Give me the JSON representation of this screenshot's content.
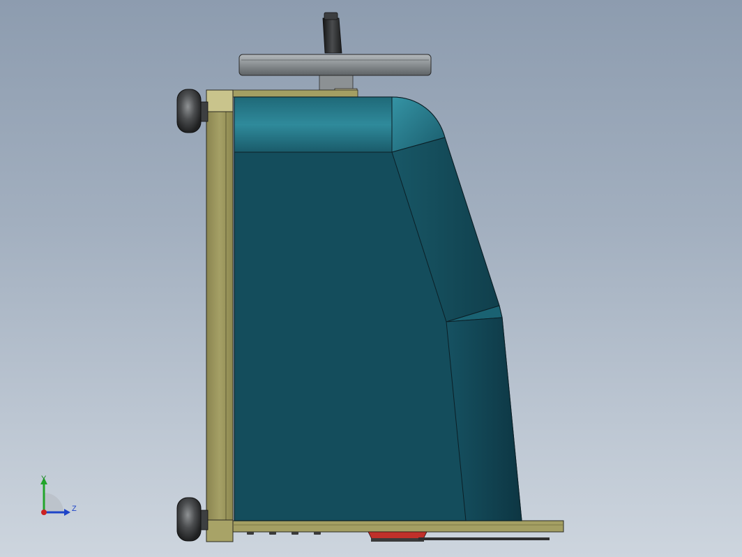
{
  "graphics_area": {
    "background_top": "#8d9caf",
    "background_bottom": "#cdd5de"
  },
  "model": {
    "view": "side",
    "body_color": "#144d5c",
    "body_highlight_color": "#2a8596",
    "frame_color": "#9a955c",
    "caster_color": "#3c3e40",
    "handwheel_color": "#8e9396",
    "handle_color": "#2a2c2e",
    "foot_accent_color": "#c0302a"
  },
  "triad": {
    "y_label": "Y",
    "z_label": "Z",
    "y_color": "#22a52b",
    "z_color": "#1e44c8",
    "x_color": "#cc2222"
  }
}
